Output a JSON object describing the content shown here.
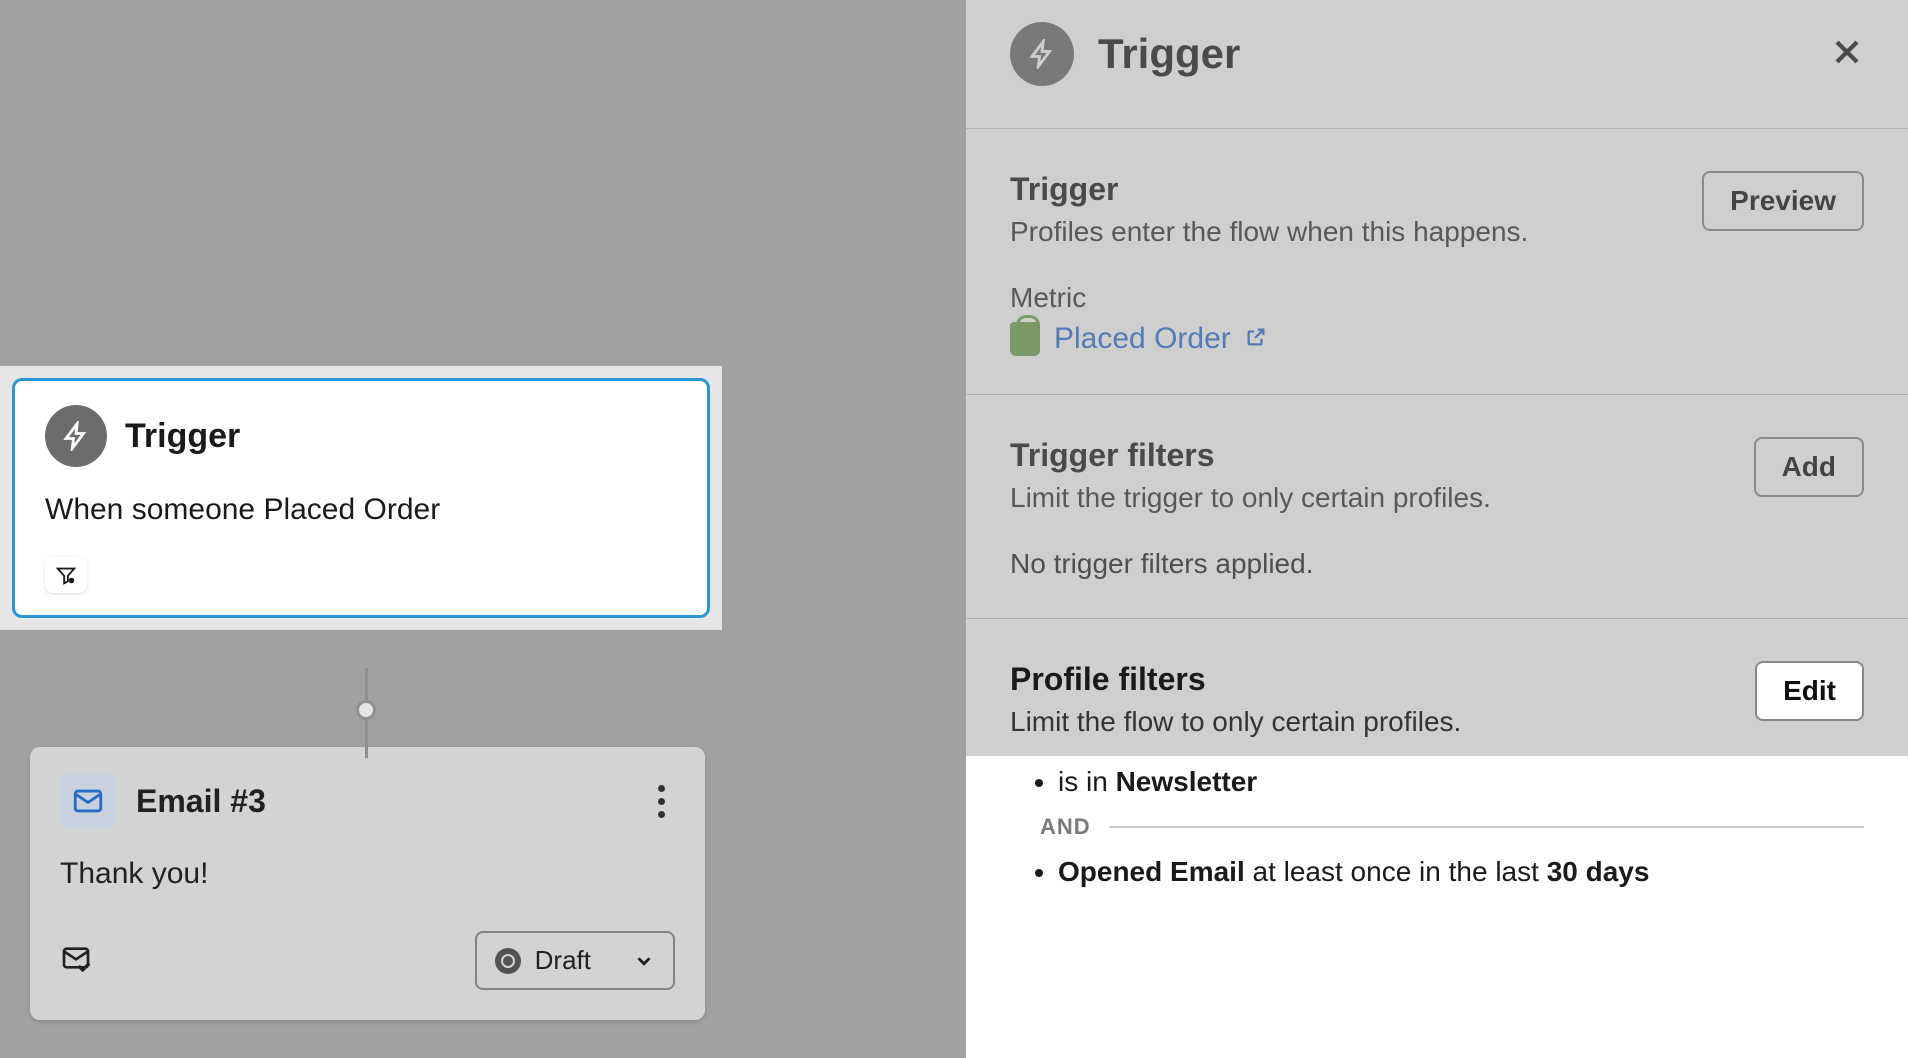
{
  "canvas": {
    "trigger_node": {
      "title": "Trigger",
      "description": "When someone Placed Order"
    },
    "email_node": {
      "title": "Email #3",
      "body": "Thank you!",
      "status": "Draft"
    }
  },
  "panel": {
    "header_title": "Trigger",
    "trigger_section": {
      "heading": "Trigger",
      "subtext": "Profiles enter the flow when this happens.",
      "button": "Preview",
      "metric_label": "Metric",
      "metric_link": "Placed Order"
    },
    "trigger_filters": {
      "heading": "Trigger filters",
      "subtext": "Limit the trigger to only certain profiles.",
      "button": "Add",
      "empty_text": "No trigger filters applied."
    },
    "profile_filters": {
      "heading": "Profile filters",
      "subtext": "Limit the flow to only certain profiles.",
      "button": "Edit",
      "rule1_prefix": "is in ",
      "rule1_bold": "Newsletter",
      "and_label": "AND",
      "rule2_bold1": "Opened Email",
      "rule2_mid": " at least once in the last ",
      "rule2_bold2": "30 days"
    }
  }
}
